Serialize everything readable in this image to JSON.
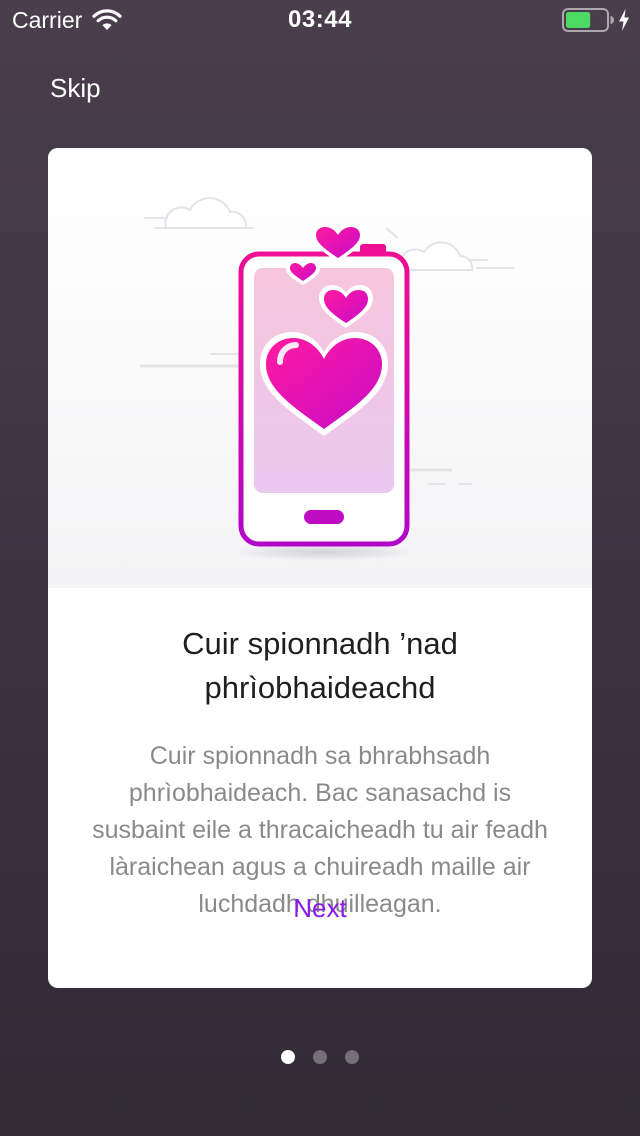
{
  "status_bar": {
    "carrier": "Carrier",
    "time": "03:44",
    "battery_level": 0.62,
    "charging": true
  },
  "onboarding": {
    "skip_label": "Skip",
    "title": "Cuir spionnadh ’nad phrìobhaideachd",
    "body": "Cuir spionnadh sa bhrabhsadh phrìobhaideach. Bac sanasachd is susbaint eile a thracaicheadh tu air feadh làraichean agus a chuireadh maille air luchdadh dhuilleagan.",
    "next_label": "Next",
    "illustration_icon": "phone-with-hearts-illustration"
  },
  "pagination": {
    "total_pages": 3,
    "current_page": 1
  },
  "colors": {
    "accent": "#8a1be6",
    "heart_pink": "#ec008c",
    "battery_green": "#4cd964",
    "background": "#3d3442"
  }
}
